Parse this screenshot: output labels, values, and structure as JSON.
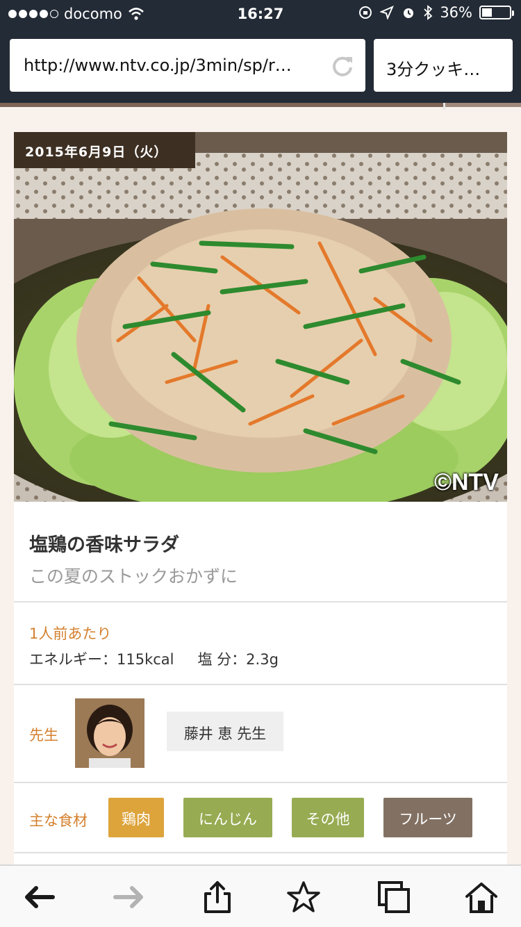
{
  "status_bar": {
    "carrier": "docomo",
    "time": "16:27",
    "battery": "36%",
    "battery_level": 0.36
  },
  "browser": {
    "url": "http://www.ntv.co.jp/3min/sp/r…",
    "page_title": "3分クッキ…",
    "load_progress": 0.85
  },
  "recipe": {
    "date": "2015年6月9日（火）",
    "photo_credit": "©NTV",
    "title": "塩鶏の香味サラダ",
    "subtitle": "この夏のストックおかずに",
    "per_serving_label": "1人前あたり",
    "energy": "エネルギー：115kcal",
    "salt": "塩 分：2.3g",
    "teacher_label": "先生",
    "teacher_name": "藤井 恵 先生",
    "ingredients_label": "主な食材",
    "tags": [
      {
        "label": "鶏肉",
        "color": "#dda43c"
      },
      {
        "label": "にんじん",
        "color": "#97ab52"
      },
      {
        "label": "その他",
        "color": "#97ab52"
      },
      {
        "label": "フルーツ",
        "color": "#827163"
      }
    ]
  },
  "toolbar": {
    "back": "back-arrow-icon",
    "forward": "forward-arrow-icon",
    "share": "share-icon",
    "bookmark": "star-icon",
    "tabs": "tabs-icon",
    "home": "home-icon"
  },
  "colors": {
    "chrome": "#232b36",
    "accent_orange": "#d4802e",
    "page_bg": "#f8f1ec"
  }
}
